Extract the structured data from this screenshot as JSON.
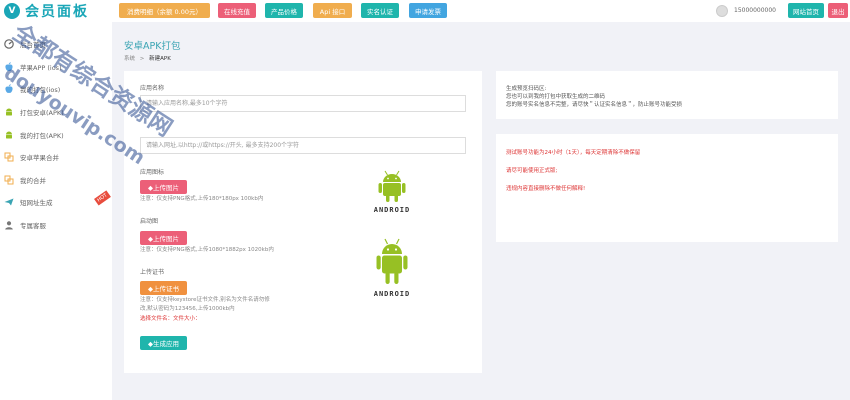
{
  "app": {
    "logo_text": "会员面板",
    "logo_mark": "V"
  },
  "sidebar": {
    "items": [
      {
        "label": "后台首页",
        "icon": "dashboard-icon"
      },
      {
        "label": "苹果APP (ios)",
        "icon": "apple-icon"
      },
      {
        "label": "我的打包(ios)",
        "icon": "apple-icon"
      },
      {
        "label": "打包安卓(APK)",
        "icon": "android-icon"
      },
      {
        "label": "我的打包(APK)",
        "icon": "android-icon"
      },
      {
        "label": "安卓苹果合并",
        "icon": "merge-icon"
      },
      {
        "label": "我的合并",
        "icon": "merge-icon"
      },
      {
        "label": "短网址生成",
        "icon": "plane-icon",
        "badge": "HOT"
      },
      {
        "label": "专属客服",
        "icon": "user-icon"
      }
    ]
  },
  "topbar": {
    "buttons": [
      {
        "label": "消费明细（余额 0.00元）",
        "color": "#f0ad4e"
      },
      {
        "label": "在线充值",
        "color": "#ec5f78"
      },
      {
        "label": "产品价格",
        "color": "#1fb5ac"
      },
      {
        "label": "Api 接口",
        "color": "#f0ad4e"
      },
      {
        "label": "实名认证",
        "color": "#1fb5ac"
      },
      {
        "label": "申请发票",
        "color": "#42a5e0"
      }
    ],
    "phone": "15000000000",
    "site_home": "网站首页",
    "logout": "退出"
  },
  "page": {
    "title": "安卓APK打包",
    "breadcrumb_home": "系统",
    "breadcrumb_sep": ">",
    "breadcrumb_current": "新建APK"
  },
  "form": {
    "app_name_label": "应用名称",
    "app_name_placeholder": "请输入应用名称,最多10个字符",
    "url_placeholder": "请输入网址,以http://或https://开头, 最多支持200个字符",
    "icon_label": "应用图标",
    "upload_image": "◆上传图片",
    "icon_note": "注意：仅支持PNG格式,上传180*180px 100kb内",
    "splash_label": "启动图",
    "splash_note": "注意：仅支持PNG格式,上传1080*1882px 1020kb内",
    "cert_label": "上传证书",
    "upload_cert": "◆上传证书",
    "cert_note_1": "注意：仅支持keystore证书文件,别名为文件名请勿修",
    "cert_note_2": "改,默认密码为123456,上传1000kb内",
    "cert_selected": "选择文件名：文件大小：",
    "generate_button": "◆生成应用",
    "android_logo_text": "ANDROID"
  },
  "info_panel": {
    "line1": "生成预览扫码区:",
    "line2": "您也可以到我的打包中获取生成的二维码",
    "line3": "您的账号实名信息不完整，请尽快＂认证实名信息＂，防止账号功能受损"
  },
  "warn_panel": {
    "line1": "测试账号功能为24小时（1天），每天定期清除不做保留",
    "line2": "请尽可能使用正式版;",
    "line3": "违规内容直接删除不做任何解释!"
  },
  "watermark": {
    "line1": "全都有综合资源网",
    "line2": "douyouvip.com"
  },
  "colors": {
    "accent": "#1aa6b7",
    "pink": "#ec5f78",
    "orange": "#f0ad4e",
    "teal": "#1fb5ac",
    "android_green": "#97c024"
  }
}
